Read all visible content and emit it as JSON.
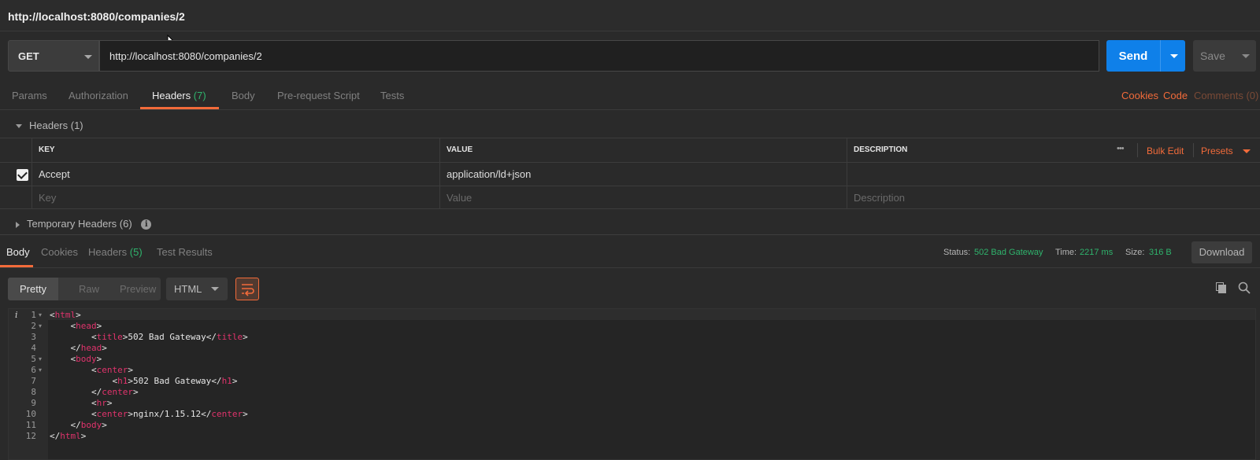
{
  "window": {
    "title": "http://localhost:8080/companies/2"
  },
  "request": {
    "method": "GET",
    "url": "http://localhost:8080/companies/2",
    "send_label": "Send",
    "save_label": "Save"
  },
  "request_tabs": [
    {
      "label": "Params"
    },
    {
      "label": "Authorization"
    },
    {
      "label": "Headers",
      "count": "(7)"
    },
    {
      "label": "Body"
    },
    {
      "label": "Pre-request Script"
    },
    {
      "label": "Tests"
    }
  ],
  "request_links": {
    "cookies": "Cookies",
    "code": "Code",
    "comments": "Comments (0)"
  },
  "headers_section": {
    "title": "Headers (1)",
    "columns": {
      "key": "KEY",
      "value": "VALUE",
      "description": "DESCRIPTION"
    },
    "more": "•••",
    "bulk_edit": "Bulk Edit",
    "presets": "Presets",
    "rows": [
      {
        "key": "Accept",
        "value": "application/ld+json",
        "description": "",
        "checked": true
      }
    ],
    "placeholders": {
      "key": "Key",
      "value": "Value",
      "description": "Description"
    }
  },
  "temporary_headers": {
    "label": "Temporary Headers",
    "count": "(6)"
  },
  "response_tabs": [
    {
      "label": "Body"
    },
    {
      "label": "Cookies"
    },
    {
      "label": "Headers",
      "count": "(5)"
    },
    {
      "label": "Test Results"
    }
  ],
  "response_status": {
    "status_label": "Status:",
    "status_value": "502 Bad Gateway",
    "time_label": "Time:",
    "time_value": "2217 ms",
    "size_label": "Size:",
    "size_value": "316 B",
    "download_label": "Download"
  },
  "view_modes": {
    "pretty": "Pretty",
    "raw": "Raw",
    "preview": "Preview",
    "format": "HTML"
  },
  "code_lines": [
    {
      "n": "1",
      "fold": true
    },
    {
      "n": "2",
      "fold": true
    },
    {
      "n": "3"
    },
    {
      "n": "4"
    },
    {
      "n": "5",
      "fold": true
    },
    {
      "n": "6",
      "fold": true
    },
    {
      "n": "7"
    },
    {
      "n": "8"
    },
    {
      "n": "9"
    },
    {
      "n": "10"
    },
    {
      "n": "11"
    },
    {
      "n": "12"
    }
  ],
  "code_text": {
    "title_text": "502 Bad Gateway",
    "h1_text": "502 Bad Gateway",
    "server": "nginx/1.15.12"
  },
  "colors": {
    "accent": "#f26b3a",
    "primary": "#0f80e9",
    "success": "#2fb36c",
    "tag": "#e0336c"
  },
  "icons": [
    "cursor-icon",
    "chevron-down-icon",
    "checkbox-icon",
    "info-icon",
    "wrap-lines-icon",
    "copy-icon",
    "search-icon"
  ]
}
